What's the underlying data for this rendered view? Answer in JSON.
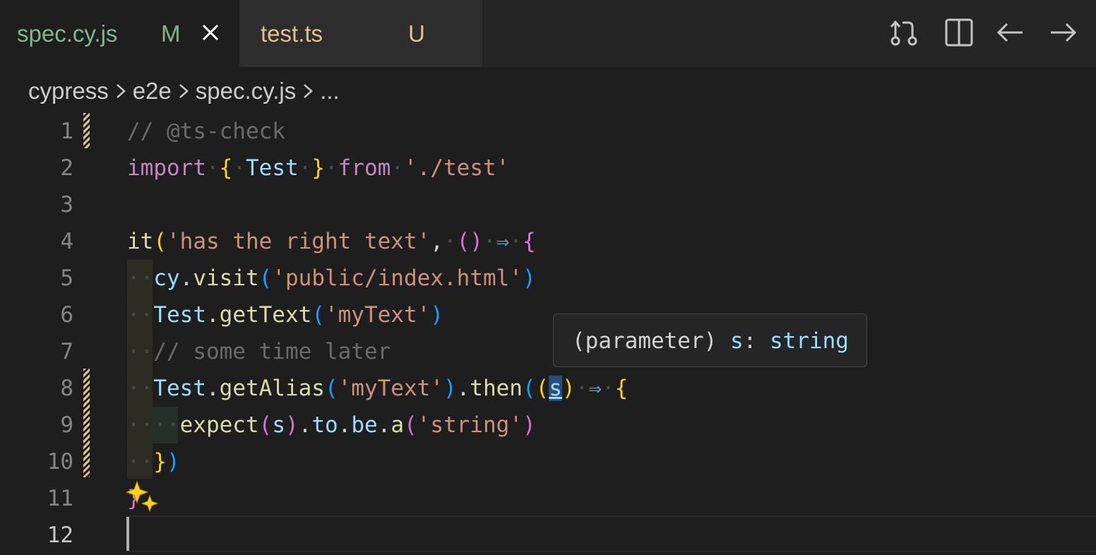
{
  "tabs": [
    {
      "label": "spec.cy.js",
      "status": "M",
      "active": true
    },
    {
      "label": "test.ts",
      "status": "U",
      "active": false
    }
  ],
  "breadcrumbs": [
    "cypress",
    "e2e",
    "spec.cy.js",
    "..."
  ],
  "line_numbers": [
    "1",
    "2",
    "3",
    "4",
    "5",
    "6",
    "7",
    "8",
    "9",
    "10",
    "11",
    "12"
  ],
  "code": {
    "l1_comment": "// @ts-check",
    "l2_import": "import",
    "l2_name": "Test",
    "l2_from": "from",
    "l2_path": "'./test'",
    "l4_it": "it",
    "l4_title": "'has the right text'",
    "l5_obj": "cy",
    "l5_method": "visit",
    "l5_arg": "'public/index.html'",
    "l6_obj": "Test",
    "l6_method": "getText",
    "l6_arg": "'myText'",
    "l7_comment": "// some time later",
    "l8_obj": "Test",
    "l8_method": "getAlias",
    "l8_arg": "'myText'",
    "l8_then": "then",
    "l8_param": "s",
    "l9_expect": "expect",
    "l9_param": "s",
    "l9_to": "to",
    "l9_be": "be",
    "l9_a": "a",
    "l9_arg": "'string'"
  },
  "hover": {
    "kind": "(parameter)",
    "name": "s",
    "type": "string"
  },
  "colors": {
    "modified": "#81b88b",
    "untracked": "#e2c08d"
  }
}
